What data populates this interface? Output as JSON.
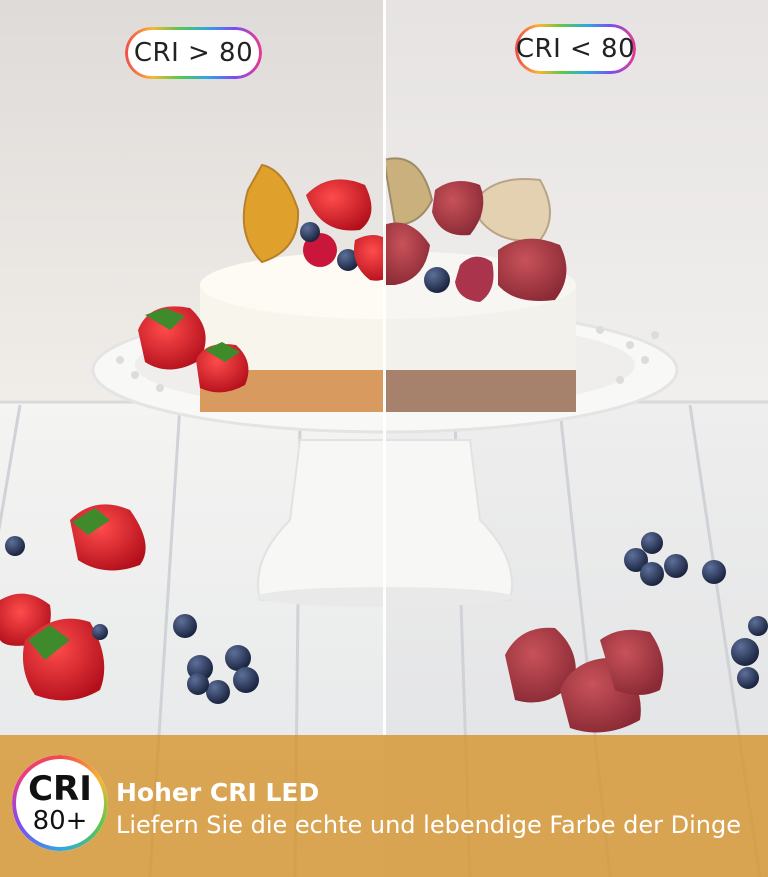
{
  "comparison": {
    "left_label": "CRI > 80",
    "right_label": "CRI < 80"
  },
  "badge": {
    "line1": "CRI",
    "line2": "80+"
  },
  "banner": {
    "title": "Hoher CRI LED",
    "subtitle": "Liefern Sie die echte und lebendige Farbe der Dinge"
  },
  "colors": {
    "banner": "#d69228",
    "accent_gradient": [
      "#f04b4b",
      "#f7b733",
      "#57c84d",
      "#2fa7e3",
      "#7b4df2",
      "#ea3a8c"
    ]
  }
}
